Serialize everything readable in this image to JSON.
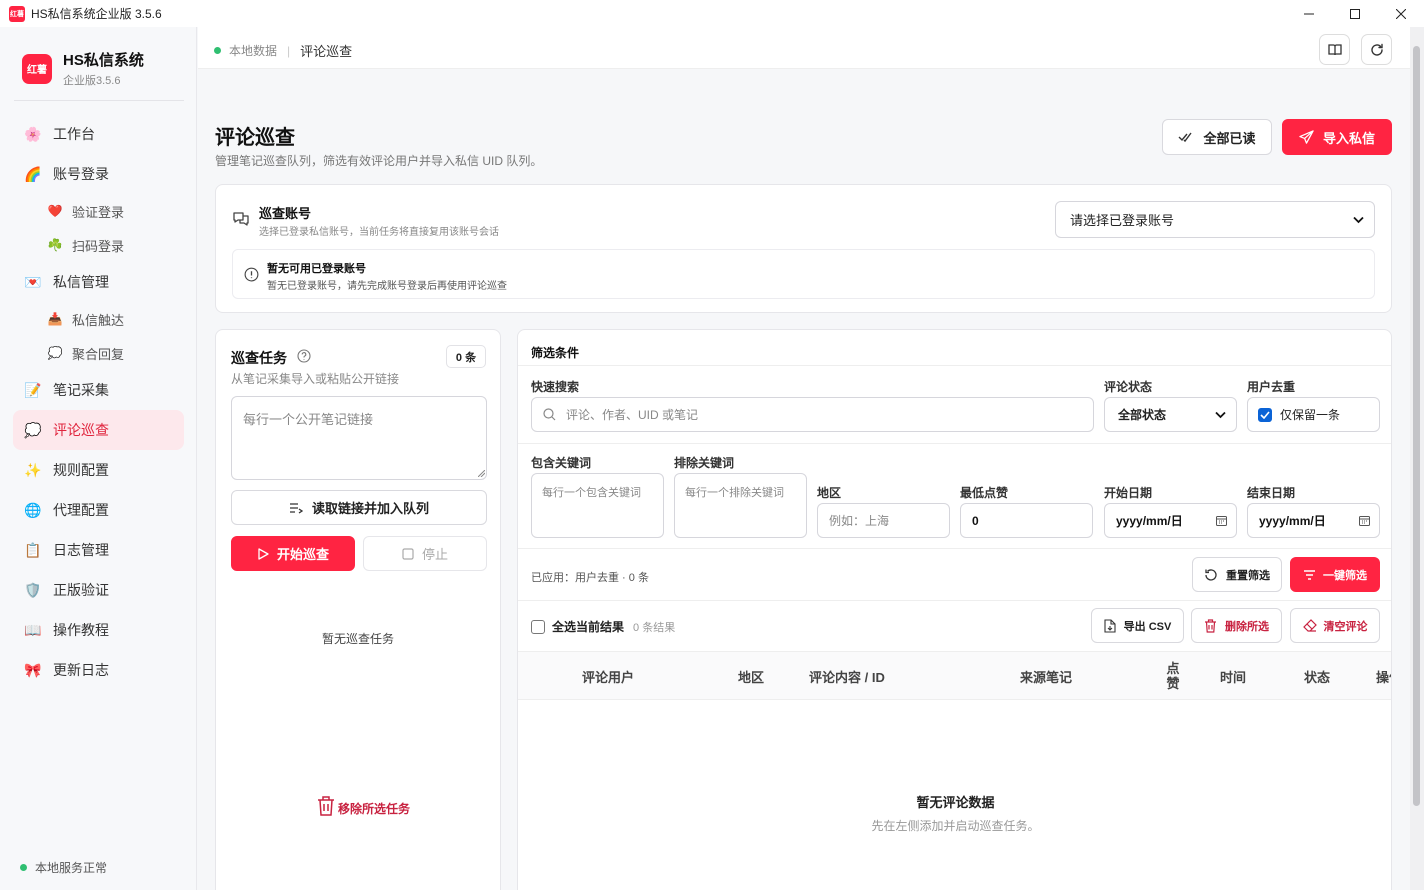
{
  "window": {
    "title": "HS私信系统企业版 3.5.6",
    "logo_text": "红薯"
  },
  "sidebar": {
    "brand_name": "HS私信系统",
    "brand_version": "企业版3.5.6",
    "logo_text": "红薯",
    "items": [
      {
        "label": "工作台",
        "icon": "flower-icon"
      },
      {
        "label": "账号登录",
        "icon": "rainbow-icon"
      },
      {
        "label": "验证登录",
        "icon": "heart-icon"
      },
      {
        "label": "扫码登录",
        "icon": "shamrock-icon"
      },
      {
        "label": "私信管理",
        "icon": "heart-letter-icon"
      },
      {
        "label": "私信触达",
        "icon": "inbox-icon"
      },
      {
        "label": "聚合回复",
        "icon": "speech-bubble-icon"
      },
      {
        "label": "笔记采集",
        "icon": "memo-icon"
      },
      {
        "label": "评论巡查",
        "icon": "speech-bubble-icon"
      },
      {
        "label": "规则配置",
        "icon": "sparkles-icon"
      },
      {
        "label": "代理配置",
        "icon": "globe-icon"
      },
      {
        "label": "日志管理",
        "icon": "clipboard-icon"
      },
      {
        "label": "正版验证",
        "icon": "shield-icon"
      },
      {
        "label": "操作教程",
        "icon": "book-icon"
      },
      {
        "label": "更新日志",
        "icon": "ribbon-icon"
      }
    ],
    "service_status": "本地服务正常"
  },
  "topbar": {
    "source": "本地数据",
    "current": "评论巡查"
  },
  "page": {
    "title": "评论巡查",
    "description": "管理笔记巡查队列，筛选有效评论用户并导入私信 UID 队列。",
    "mark_all_read": "全部已读",
    "import_dm": "导入私信"
  },
  "account": {
    "title": "巡查账号",
    "subtitle": "选择已登录私信账号，当前任务将直接复用该账号会话",
    "select_value": "请选择已登录账号",
    "notice_title": "暂无可用已登录账号",
    "notice_text": "暂无已登录账号，请先完成账号登录后再使用评论巡查"
  },
  "tasks": {
    "title": "巡查任务",
    "count_badge": "0 条",
    "subtitle": "从笔记采集导入或粘贴公开链接",
    "link_placeholder": "每行一个公开笔记链接",
    "read_links_button": "读取链接并加入队列",
    "start_button": "开始巡查",
    "stop_button": "停止",
    "empty": "暂无巡查任务",
    "remove_selected": "移除所选任务"
  },
  "filters": {
    "title": "筛选条件",
    "quick_search_label": "快速搜索",
    "quick_search_placeholder": "评论、作者、UID 或笔记",
    "status_label": "评论状态",
    "status_value": "全部状态",
    "dedupe_label": "用户去重",
    "dedupe_option": "仅保留一条",
    "include_label": "包含关键词",
    "include_placeholder": "每行一个包含关键词",
    "exclude_label": "排除关键词",
    "exclude_placeholder": "每行一个排除关键词",
    "region_label": "地区",
    "region_placeholder": "例如：上海",
    "min_likes_label": "最低点赞",
    "min_likes_value": "0",
    "start_date_label": "开始日期",
    "start_date_value": "yyyy/mm/日",
    "end_date_label": "结束日期",
    "end_date_value": "yyyy/mm/日",
    "applied": "已应用：用户去重 · 0 条",
    "reset_button": "重置筛选",
    "apply_button": "一键筛选"
  },
  "results": {
    "select_all": "全选当前结果",
    "count": "0 条结果",
    "export_csv": "导出 CSV",
    "delete_selected": "删除所选",
    "clear_comments": "清空评论",
    "columns": [
      "评论用户",
      "地区",
      "评论内容 / ID",
      "来源笔记",
      "点赞",
      "时间",
      "状态",
      "操作"
    ],
    "empty_title": "暂无评论数据",
    "empty_text": "先在左侧添加并启动巡查任务。"
  },
  "colors": {
    "accent": "#ff2442",
    "active_bg": "#fde8ec",
    "ok": "#2fbf71"
  }
}
